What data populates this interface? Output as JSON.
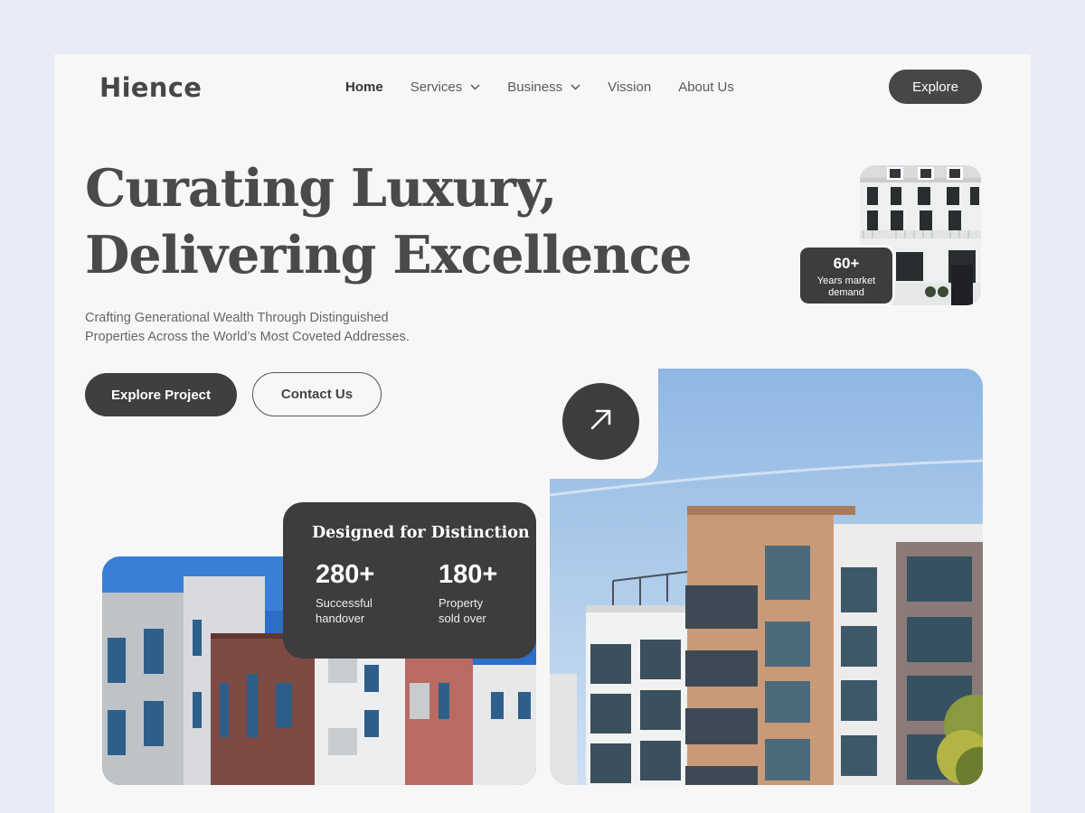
{
  "brand": {
    "name": "Hience"
  },
  "nav": {
    "items": [
      {
        "label": "Home",
        "active": true,
        "dropdown": false
      },
      {
        "label": "Services",
        "active": false,
        "dropdown": true
      },
      {
        "label": "Business",
        "active": false,
        "dropdown": true
      },
      {
        "label": "Vission",
        "active": false,
        "dropdown": false
      },
      {
        "label": "About Us",
        "active": false,
        "dropdown": false
      }
    ],
    "cta_label": "Explore"
  },
  "hero": {
    "title_line1": "Curating Luxury,",
    "title_line2": "Delivering Excellence",
    "subtitle_line1": "Crafting Generational Wealth Through Distinguished",
    "subtitle_line2": "Properties Across the World’s Most Coveted Addresses.",
    "primary_button": "Explore Project",
    "secondary_button": "Contact Us"
  },
  "badge": {
    "value": "60+",
    "label_line1": "Years market",
    "label_line2": "demand"
  },
  "distinction": {
    "title": "Designed for Distinction",
    "stats": [
      {
        "value": "280+",
        "label_line1": "Successful",
        "label_line2": "handover"
      },
      {
        "value": "180+",
        "label_line1": "Property",
        "label_line2": "sold over"
      }
    ]
  },
  "icons": {
    "arrow": "arrow-up-right-icon",
    "chevron": "chevron-down-icon"
  },
  "colors": {
    "background": "#e8eaf6",
    "surface": "#f7f7f7",
    "dark": "#3d3d3d",
    "text": "#4a4a4a"
  }
}
